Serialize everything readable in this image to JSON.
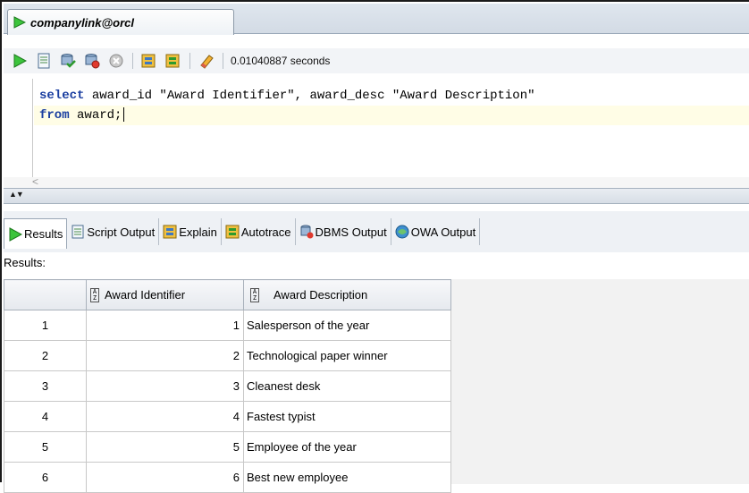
{
  "document_tab": {
    "title": "companylink@orcl",
    "icon": "run-icon"
  },
  "toolbar": {
    "buttons": [
      {
        "name": "run-statement-button",
        "icon": "play-icon"
      },
      {
        "name": "run-script-button",
        "icon": "script-icon"
      },
      {
        "name": "commit-button",
        "icon": "commit-icon"
      },
      {
        "name": "rollback-button",
        "icon": "rollback-icon"
      },
      {
        "name": "cancel-button",
        "icon": "cancel-icon"
      },
      {
        "name": "explain-plan-button",
        "icon": "explain-icon"
      },
      {
        "name": "autotrace-button",
        "icon": "autotrace-icon"
      },
      {
        "name": "clear-button",
        "icon": "eraser-icon"
      }
    ],
    "elapsed": "0.01040887 seconds"
  },
  "editor": {
    "line1": {
      "kw": "select",
      "rest": " award_id \"Award Identifier\", award_desc \"Award Description\""
    },
    "line2": {
      "kw": "from",
      "rest": " award;"
    }
  },
  "result_tabs": [
    {
      "label": "Results",
      "icon": "play-icon",
      "active": true
    },
    {
      "label": "Script Output",
      "icon": "script-icon"
    },
    {
      "label": "Explain",
      "icon": "explain-icon"
    },
    {
      "label": "Autotrace",
      "icon": "autotrace-icon"
    },
    {
      "label": "DBMS Output",
      "icon": "dbms-icon"
    },
    {
      "label": "OWA Output",
      "icon": "owa-icon"
    }
  ],
  "results_label": "Results:",
  "grid": {
    "columns": [
      "",
      "Award Identifier",
      "Award Description"
    ],
    "rows": [
      [
        "1",
        "1",
        "Salesperson of the year"
      ],
      [
        "2",
        "2",
        "Technological paper winner"
      ],
      [
        "3",
        "3",
        "Cleanest desk"
      ],
      [
        "4",
        "4",
        "Fastest typist"
      ],
      [
        "5",
        "5",
        "Employee of the year"
      ],
      [
        "6",
        "6",
        "Best new employee"
      ]
    ]
  },
  "colors": {
    "keyword": "#1a3ea0",
    "accent_green": "#2e9a2e"
  }
}
